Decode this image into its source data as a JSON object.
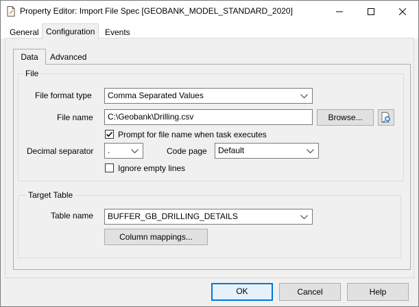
{
  "window": {
    "title": "Property Editor: Import File Spec [GEOBANK_MODEL_STANDARD_2020]",
    "title_icon": "document-pen-icon"
  },
  "tabs": {
    "general": "General",
    "configuration": "Configuration",
    "events": "Events"
  },
  "subtabs": {
    "data": "Data",
    "advanced": "Advanced"
  },
  "file_group": {
    "legend": "File",
    "file_format_label": "File format type",
    "file_format_value": "Comma Separated Values",
    "file_name_label": "File name",
    "file_name_value": "C:\\Geobank\\Drilling.csv",
    "browse_label": "Browse...",
    "prompt_label": "Prompt for file name when task executes",
    "prompt_checked": true,
    "decimal_label": "Decimal separator",
    "decimal_value": ".",
    "code_page_label": "Code page",
    "code_page_value": "Default",
    "ignore_empty_label": "Ignore empty lines",
    "ignore_empty_checked": false
  },
  "target_group": {
    "legend": "Target Table",
    "table_name_label": "Table name",
    "table_name_value": "BUFFER_GB_DRILLING_DETAILS",
    "column_mappings_label": "Column mappings..."
  },
  "footer": {
    "ok": "OK",
    "cancel": "Cancel",
    "help": "Help"
  },
  "colors": {
    "dialog_bg": "#f0f0f0",
    "accent": "#0078d7"
  }
}
